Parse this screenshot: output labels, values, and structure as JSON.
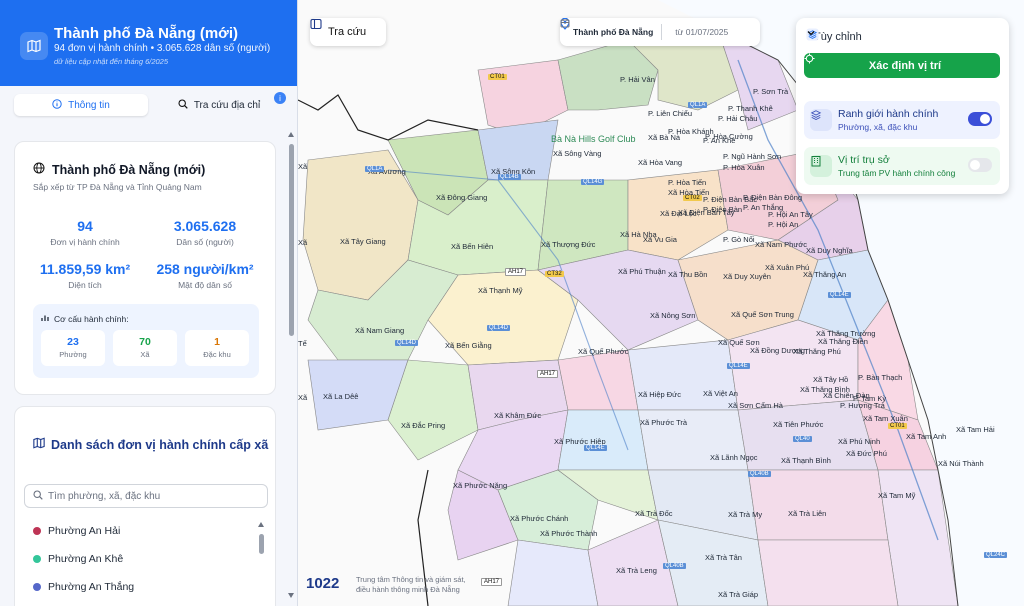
{
  "header": {
    "title": "Thành phố Đà Nẵng (mới)",
    "subtitle": "94 đơn vị hành chính • 3.065.628 dân số (người)",
    "note": "dữ liệu cập nhật đến tháng 6/2025"
  },
  "tabs": [
    {
      "label": "Thông tin"
    },
    {
      "label": "Tra cứu địa chỉ"
    }
  ],
  "tab_badge": "i",
  "info_card": {
    "title": "Thành phố Đà Nẵng (mới)",
    "subtitle": "Sắp xếp từ TP Đà Nẵng và Tỉnh Quảng Nam",
    "stats": [
      {
        "value": "94",
        "label": "Đơn vị hành chính"
      },
      {
        "value": "3.065.628",
        "label": "Dân số (người)"
      },
      {
        "value": "11.859,59 km²",
        "label": "Diện tích"
      },
      {
        "value": "258 người/km²",
        "label": "Mật độ dân số"
      }
    ],
    "structure": {
      "title": "Cơ cấu hành chính:",
      "items": [
        {
          "count": "23",
          "label": "Phường",
          "color": "#1e6ff0"
        },
        {
          "count": "70",
          "label": "Xã",
          "color": "#16a34a"
        },
        {
          "count": "1",
          "label": "Đặc khu",
          "color": "#d97706"
        }
      ]
    }
  },
  "list_card": {
    "title": "Danh sách đơn vị hành chính cấp xã",
    "search_placeholder": "Tìm phường, xã, đặc khu",
    "items": [
      {
        "label": "Phường An Hải",
        "color": "#be3455"
      },
      {
        "label": "Phường An Khê",
        "color": "#34c69a"
      },
      {
        "label": "Phường An Thắng",
        "color": "#5567c9"
      }
    ]
  },
  "map": {
    "lookup_button": "Tra cứu",
    "city_label": "Thành phố Đà Nẵng",
    "date_label": "từ 01/07/2025",
    "panel": {
      "title": "Tùy chỉnh",
      "locate_button": "Xác định vị trí",
      "layers": [
        {
          "title": "Ranh giới hành chính",
          "subtitle": "Phường, xã, đặc khu",
          "enabled": true
        },
        {
          "title": "Vị trí trụ sở",
          "subtitle": "Trung tâm PV hành chính công",
          "enabled": false
        }
      ]
    },
    "logo_text": "1022",
    "credit": [
      "Trung tâm Thông tin và giám sát,",
      "điều hành thông minh Đà Nẵng"
    ],
    "poi": "Bà Nà Hills Golf Club",
    "left_edge_labels": [
      "Tế",
      "Xã",
      "Xã",
      "Xã"
    ],
    "place_labels": [
      "P. Hải Vân",
      "P. Sơn Trà",
      "P. Liên Chiểu",
      "P. Thanh Khê",
      "P. Hải Châu",
      "P. Hòa Khánh",
      "P. An Khê",
      "P. Hòa Cường",
      "P. Ngũ Hành Sơn",
      "P. Hòa Xuân",
      "Xã Hòa Vang",
      "Xã Bà Nà",
      "Xã Sông Vàng",
      "P. Hòa Tiến",
      "Xã Hòa Tiến",
      "P. Điện Bàn Bắc",
      "P. Điện Bàn Đông",
      "Xã Điện Bàn Tây",
      "P. Điện Bàn",
      "P. An Thắng",
      "P. Hội An Tây",
      "P. Hội An",
      "Xã Avương",
      "Xã Sông Kôn",
      "Xã Đông Giang",
      "Xã Tây Giang",
      "Xã Bến Hiên",
      "Xã Thượng Đức",
      "Xã Đại Lộc",
      "Xã Hà Nha",
      "Xã Vu Gia",
      "P. Gò Nổi",
      "Xã Nam Phước",
      "Xã Duy Nghĩa",
      "Xã Thạnh Mỹ",
      "Xã Phú Thuận",
      "Xã Thu Bồn",
      "Xã Duy Xuyên",
      "Xã Xuân Phú",
      "Xã Thăng An",
      "Xã Nam Giang",
      "Xã Bến Giằng",
      "Xã Nông Sơn",
      "Xã Quế Sơn Trung",
      "Xã Quế Sơn",
      "Xã Thăng Trường",
      "Xã Thăng Điền",
      "Xã Thăng Phú",
      "Xã Đồng Dương",
      "Xã Quế Phước",
      "Xã La Dêê",
      "Xã Tây Hồ",
      "Xã Thăng Bình",
      "Xã Hiệp Đức",
      "Xã Việt An",
      "Xã Chiên Đàn",
      "P. Hương Trà",
      "P. Tam Kỳ",
      "Xã Sơn Cẩm Hà",
      "Xã Đắc Pring",
      "Xã Khâm Đức",
      "Xã Phước Trà",
      "Xã Tiên Phước",
      "Xã Tam Anh",
      "Xã Tam Hải",
      "Xã Phước Hiệp",
      "Xã Lãnh Ngọc",
      "Xã Thạnh Bình",
      "Xã Phú Ninh",
      "Xã Đức Phú",
      "Xã Núi Thành",
      "Xã Phước Năng",
      "Xã Tam Mỹ",
      "Xã Phước Chánh",
      "Xã Trà Đốc",
      "Xã Trà My",
      "Xã Trà Liên",
      "Xã Phước Thành",
      "Xã Trà Tân",
      "Xã Trà Leng",
      "Xã Trà Giáp",
      "Xã Tam Xuân",
      "P. Bàn Thạch"
    ],
    "road_labels": [
      "CT01",
      "QL1A",
      "QL14B",
      "QL14G",
      "QL1A",
      "CT02",
      "AH17",
      "CT32",
      "QL14D",
      "QL14D",
      "AH17",
      "QL14E",
      "QL14E",
      "QL40B",
      "QL24C",
      "QL40B",
      "AH17",
      "CT01",
      "QL14E",
      "QL40"
    ]
  }
}
